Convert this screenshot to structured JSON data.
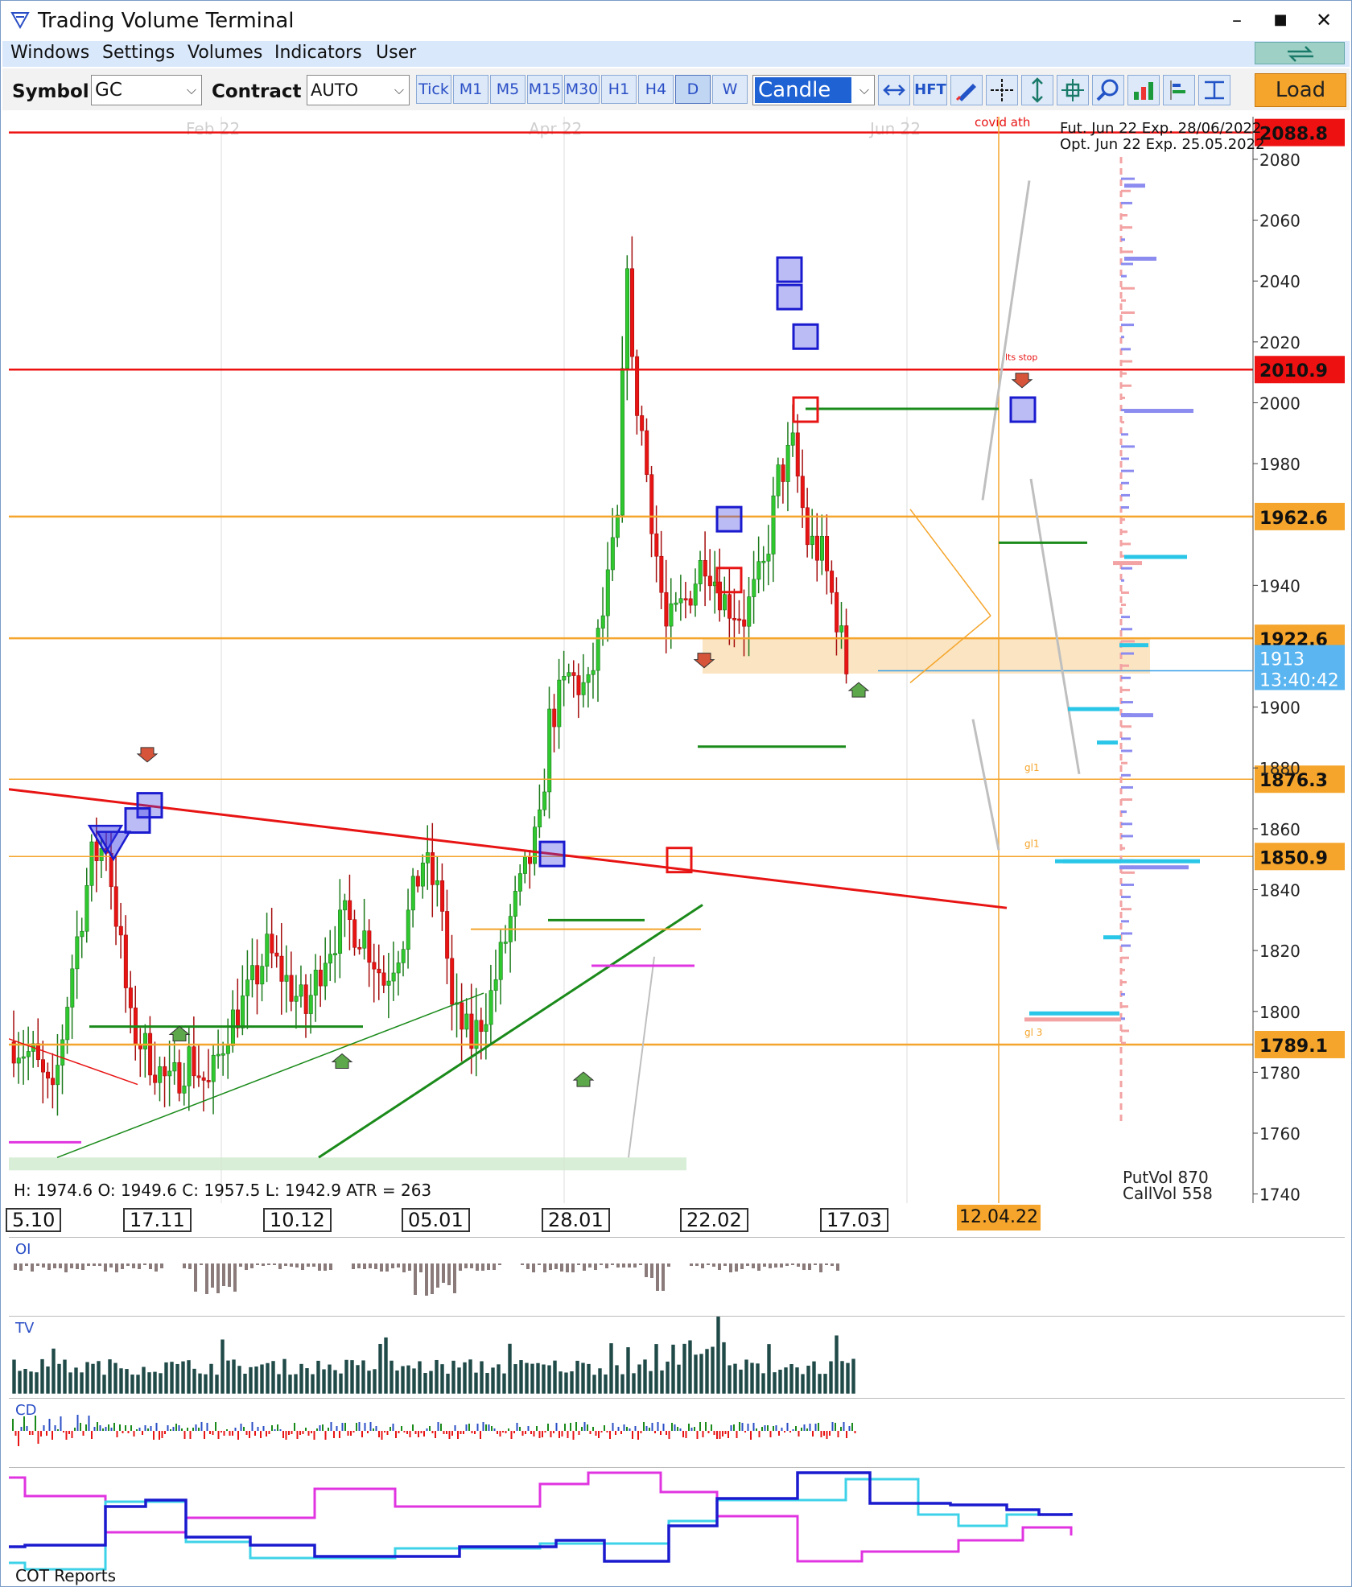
{
  "window": {
    "title": "Trading Volume Terminal",
    "minimize": "–",
    "maximize": "■",
    "close": "✕"
  },
  "menu": {
    "items": [
      "Windows",
      "Settings",
      "Volumes",
      "Indicators",
      "User"
    ]
  },
  "toolbar": {
    "symbol_label": "Symbol",
    "symbol_value": "GC",
    "contract_label": "Contract",
    "contract_value": "AUTO",
    "timeframes": [
      "Tick",
      "M1",
      "M5",
      "M15",
      "M30",
      "H1",
      "H4",
      "D",
      "W"
    ],
    "active_timeframe": "D",
    "chart_type": "Candle",
    "hft_label": "HFT",
    "load_label": "Load"
  },
  "chart": {
    "month_labels": [
      "Feb 22",
      "Apr 22",
      "Jun 22"
    ],
    "annotation_top": "covid ath",
    "contract_info": [
      "Fut. Jun 22 Exp. 28/06/2022",
      "Opt. Jun 22 Exp. 25.05.2022"
    ],
    "info_line": "H: 1974.6   O: 1949.6   C: 1957.5   L: 1942.9   ATR = 263",
    "putvol": "PutVol  870",
    "callvol": "CallVol  558",
    "stop_label": "lts stop",
    "gl_labels": [
      "gl1",
      "gl1",
      "gl 3"
    ],
    "current_price": "1913",
    "countdown": "13:40:42",
    "price_levels": [
      {
        "label": "2088.8",
        "price": 2088.8,
        "color": "#ee1111"
      },
      {
        "label": "2010.9",
        "price": 2010.9,
        "color": "#ee1111"
      },
      {
        "label": "1962.6",
        "price": 1962.6,
        "color": "#f5a52b"
      },
      {
        "label": "1922.6",
        "price": 1922.6,
        "color": "#f5a52b"
      },
      {
        "label": "1876.3",
        "price": 1876.3,
        "color": "#f5a52b"
      },
      {
        "label": "1850.9",
        "price": 1850.9,
        "color": "#f5a52b"
      },
      {
        "label": "1789.1",
        "price": 1789.1,
        "color": "#f5a52b"
      }
    ],
    "y_ticks": [
      2080,
      2060,
      2040,
      2020,
      2000,
      1980,
      1940,
      1900,
      1880,
      1860,
      1840,
      1820,
      1800,
      1780,
      1760,
      1740
    ]
  },
  "date_axis": {
    "labels": [
      "5.10",
      "17.11",
      "10.12",
      "05.01",
      "28.01",
      "22.02",
      "17.03"
    ],
    "current": "12.04.22"
  },
  "panels": {
    "oi": "OI",
    "tv": "TV",
    "cd": "CD",
    "cot": "COT Reports"
  },
  "chart_data": {
    "type": "candlestick",
    "symbol": "GC",
    "y_range": [
      1737,
      2094
    ],
    "last_bar": {
      "high": 1974.6,
      "open": 1949.6,
      "close": 1957.5,
      "low": 1942.9
    },
    "current_price": 1913,
    "close_path": [
      [
        0,
        1790
      ],
      [
        4,
        1785
      ],
      [
        8,
        1770
      ],
      [
        12,
        1815
      ],
      [
        16,
        1850
      ],
      [
        19,
        1855
      ],
      [
        22,
        1820
      ],
      [
        24,
        1795
      ],
      [
        28,
        1785
      ],
      [
        32,
        1775
      ],
      [
        36,
        1785
      ],
      [
        40,
        1775
      ],
      [
        44,
        1795
      ],
      [
        48,
        1805
      ],
      [
        52,
        1820
      ],
      [
        56,
        1810
      ],
      [
        60,
        1800
      ],
      [
        64,
        1820
      ],
      [
        68,
        1830
      ],
      [
        72,
        1825
      ],
      [
        76,
        1810
      ],
      [
        80,
        1825
      ],
      [
        84,
        1850
      ],
      [
        88,
        1835
      ],
      [
        90,
        1800
      ],
      [
        94,
        1790
      ],
      [
        98,
        1805
      ],
      [
        102,
        1830
      ],
      [
        106,
        1850
      ],
      [
        108,
        1860
      ],
      [
        110,
        1895
      ],
      [
        114,
        1910
      ],
      [
        118,
        1905
      ],
      [
        121,
        1930
      ],
      [
        124,
        1960
      ],
      [
        126,
        2050
      ],
      [
        127,
        2010
      ],
      [
        129,
        1990
      ],
      [
        132,
        1950
      ],
      [
        134,
        1925
      ],
      [
        138,
        1935
      ],
      [
        142,
        1950
      ],
      [
        146,
        1935
      ],
      [
        150,
        1930
      ],
      [
        154,
        1945
      ],
      [
        157,
        1975
      ],
      [
        160,
        1985
      ],
      [
        163,
        1955
      ],
      [
        166,
        1950
      ],
      [
        169,
        1930
      ],
      [
        171,
        1913
      ]
    ]
  }
}
